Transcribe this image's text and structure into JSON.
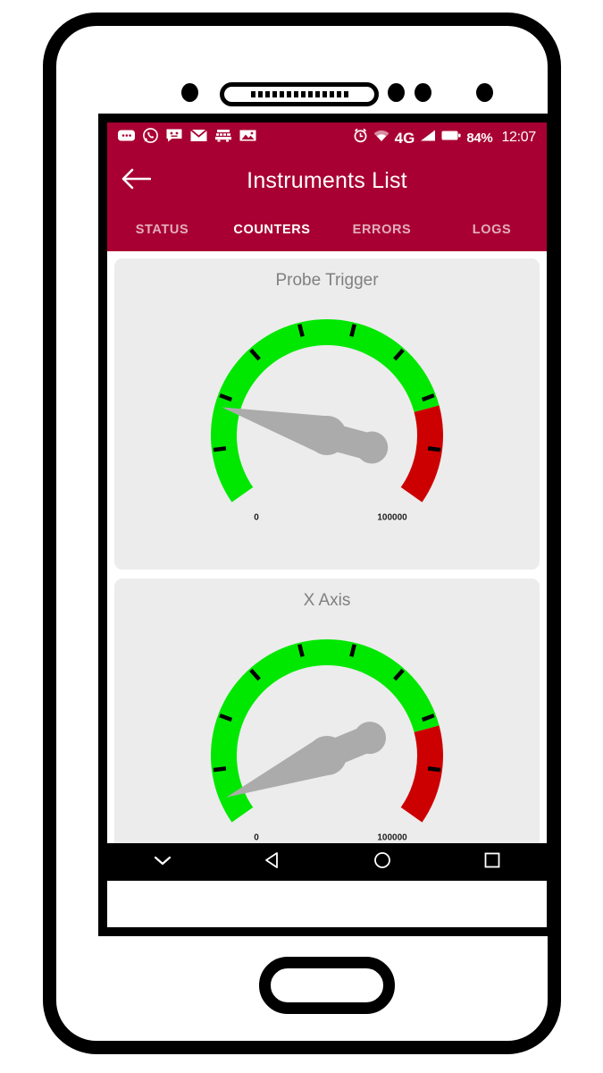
{
  "colors": {
    "brand": "#A80032",
    "gauge_green": "#00E800",
    "gauge_red": "#CC0000",
    "needle_gray": "#ABABAB",
    "card_bg": "#ECECEC",
    "title_gray": "#808080",
    "navbar": "#000000"
  },
  "status_bar": {
    "left_icons": [
      {
        "name": "sms-icon",
        "label": "SMS"
      },
      {
        "name": "whatsapp-icon",
        "label": "WhatsApp"
      },
      {
        "name": "chat-face-icon",
        "label": "Chat"
      },
      {
        "name": "email-icon",
        "label": "Email"
      },
      {
        "name": "transit-icon",
        "label": "Transit"
      },
      {
        "name": "photo-icon",
        "label": "Photo"
      }
    ],
    "right_icons": [
      {
        "name": "alarm-clock-icon",
        "label": "Alarm"
      },
      {
        "name": "wifi-icon",
        "label": "Wi-Fi"
      },
      {
        "name": "network-type-icon",
        "label": "4G"
      },
      {
        "name": "signal-bars-icon",
        "label": "Signal"
      },
      {
        "name": "battery-icon",
        "label": "Battery"
      }
    ],
    "network_type": "4G",
    "battery_percent": "84%",
    "clock": "12:07"
  },
  "app_bar": {
    "back_icon": "arrow-left-icon",
    "title": "Instruments List"
  },
  "tabs": [
    {
      "label": "STATUS",
      "active": false
    },
    {
      "label": "COUNTERS",
      "active": true
    },
    {
      "label": "ERRORS",
      "active": false
    },
    {
      "label": "LOGS",
      "active": false
    }
  ],
  "chart_data": [
    {
      "type": "gauge",
      "title": "Probe Trigger",
      "min": 0,
      "max": 100000,
      "min_label": "0",
      "max_label": "100000",
      "value": 20000,
      "value_fraction": 0.2,
      "start_angle_deg": 215,
      "sweep_deg": 250,
      "tick_count": 8,
      "bands": [
        {
          "name": "normal",
          "from": 0,
          "to": 80000,
          "color": "#00E800"
        },
        {
          "name": "critical",
          "from": 80000,
          "to": 100000,
          "color": "#CC0000"
        }
      ],
      "needle_color": "#ABABAB",
      "grid": false,
      "legend": "none"
    },
    {
      "type": "gauge",
      "title": "X Axis",
      "min": 0,
      "max": 100000,
      "min_label": "0",
      "max_label": "100000",
      "value": 5000,
      "value_fraction": 0.05,
      "start_angle_deg": 215,
      "sweep_deg": 250,
      "tick_count": 8,
      "bands": [
        {
          "name": "normal",
          "from": 0,
          "to": 80000,
          "color": "#00E800"
        },
        {
          "name": "critical",
          "from": 80000,
          "to": 100000,
          "color": "#CC0000"
        }
      ],
      "needle_color": "#ABABAB",
      "grid": false,
      "legend": "none"
    }
  ],
  "nav_bar": {
    "buttons": [
      {
        "name": "hide-keyboard-icon",
        "label": "Hide keyboard"
      },
      {
        "name": "back-triangle-icon",
        "label": "Back"
      },
      {
        "name": "home-circle-icon",
        "label": "Home"
      },
      {
        "name": "recents-square-icon",
        "label": "Recents"
      }
    ]
  },
  "device": {
    "earpiece": "earpiece-speaker",
    "home_button": "home-button"
  }
}
